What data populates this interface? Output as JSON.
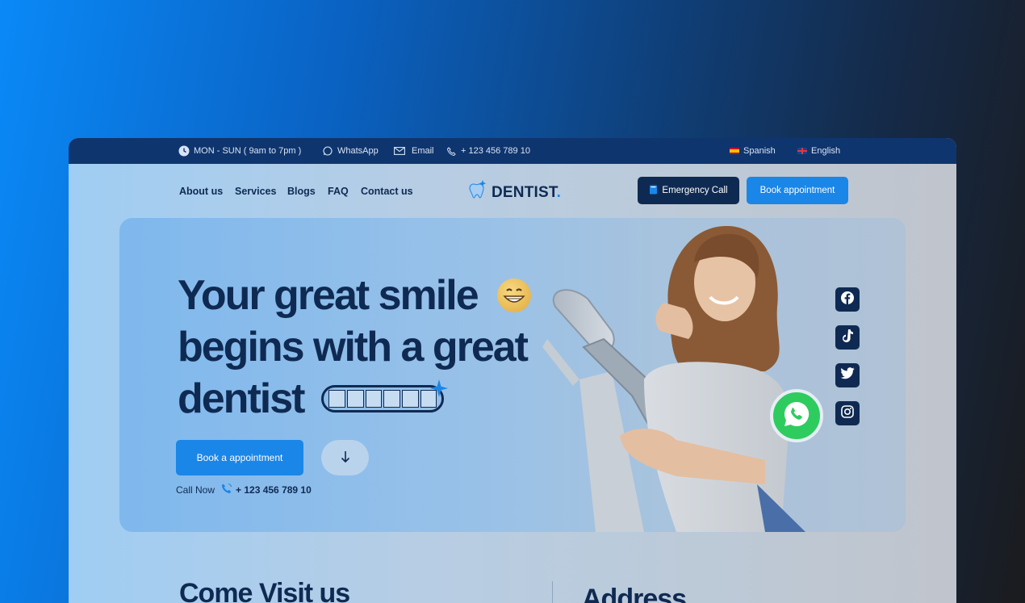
{
  "topbar": {
    "hours": "MON - SUN ( 9am to 7pm )",
    "whatsapp": "WhatsApp",
    "email": "Email",
    "phone": "+ 123 456 789 10",
    "lang_spanish": "Spanish",
    "lang_english": "English"
  },
  "nav": {
    "links": [
      "About us",
      "Services",
      "Blogs",
      "FAQ",
      "Contact us"
    ],
    "logo": "DENTIST",
    "logo_dot": ".",
    "emergency_label": "Emergency Call",
    "book_label": "Book appointment"
  },
  "hero": {
    "line1": "Your great smile",
    "line2": "begins with a great",
    "line3": "dentist",
    "book_label": "Book a appointment",
    "call_label": "Call Now",
    "call_number": "+ 123 456 789 10"
  },
  "social_icons": [
    "facebook-icon",
    "tiktok-icon",
    "twitter-icon",
    "instagram-icon"
  ],
  "below": {
    "visit_title": "Come Visit us",
    "address_title": "Address"
  },
  "colors": {
    "navy": "#0f2a52",
    "accent": "#1a86e8",
    "topbar": "#0f356e",
    "whatsapp": "#2ecc5e"
  }
}
